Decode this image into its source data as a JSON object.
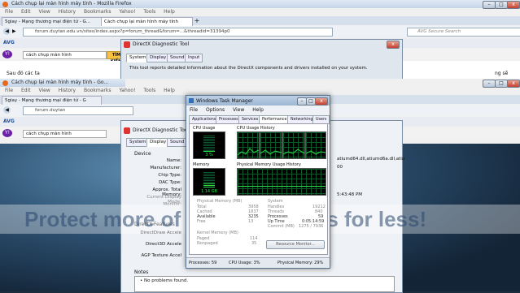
{
  "bg_browser": {
    "title": "Cách chụp lại màn hình máy tính - Mozilla Firefox",
    "menu": [
      "File",
      "Edit",
      "View",
      "History",
      "Bookmarks",
      "Yahoo!",
      "Tools",
      "Help"
    ],
    "tabs": [
      "5giay - Mạng thương mại điện tử - G...",
      "Cách chụp lại màn hình máy tính"
    ],
    "url": "forum.duytan.edu.vn/sites/index.aspx?p=forum_thread&forum=...&threadid=31394p0",
    "search_placeholder": "AVG Secure Search",
    "search_query": "cách chụp màn hình",
    "search_button": "TÌM KIẾM",
    "content_snippet": "Sau đó các ta",
    "content_snippet_right": "ng sẽ"
  },
  "bg_dxdiag": {
    "title": "DirectX Diagnostic Tool",
    "tabs": [
      "System",
      "Display",
      "Sound",
      "Input"
    ],
    "intro": "This tool reports detailed information about the DirectX components and drivers installed on your system."
  },
  "fg_browser": {
    "title": "Cách chụp lại màn hình máy tính - Go...",
    "menu": [
      "File",
      "Edit",
      "View",
      "History",
      "Bookmarks",
      "Yahoo!",
      "Tools",
      "Help"
    ],
    "tab": "5giay - Mạng thương mại điện tử - G",
    "url": "forum.duytan",
    "search_query": "cách chụp màn hình"
  },
  "fg_dxdiag": {
    "title": "DirectX Diagnostic Tool",
    "tabs": [
      "System",
      "Display",
      "Sound"
    ],
    "device_group": "Device",
    "fields": [
      "Name:",
      "Manufacturer:",
      "Chip Type:",
      "DAC Type:",
      "Approx. Total Memory:",
      "Current Display Mode:",
      "Monitor:"
    ],
    "right_values": [
      "atiumd64.dll,atiumd6a.dll,atiu",
      "00",
      "",
      "5:43:48 PM"
    ],
    "directx_features": "DirectX Features",
    "feature_rows": [
      "DirectDraw Accele",
      "Direct3D Accele",
      "AGP Texture Accel"
    ],
    "notes_label": "Notes",
    "notes_item": "No problems found."
  },
  "task_manager": {
    "title": "Windows Task Manager",
    "menu": [
      "File",
      "Options",
      "View",
      "Help"
    ],
    "tabs": [
      "Applications",
      "Processes",
      "Services",
      "Performance",
      "Networking",
      "Users"
    ],
    "active_tab": "Performance",
    "cpu_usage_label": "CPU Usage",
    "cpu_history_label": "CPU Usage History",
    "memory_label": "Memory",
    "memory_history_label": "Physical Memory Usage History",
    "cpu_value": "3 %",
    "mem_value": "1.14 GB",
    "physmem_header": "Physical Memory (MB)",
    "physmem_rows": [
      [
        "Total",
        "3958"
      ],
      [
        "Cached",
        "1837"
      ],
      [
        "Available",
        "3235"
      ],
      [
        "Free",
        "13"
      ]
    ],
    "system_header": "System",
    "system_rows": [
      [
        "Handles",
        "19212"
      ],
      [
        "Threads",
        "840"
      ],
      [
        "Processes",
        "59"
      ],
      [
        "Up Time",
        "0:05:14:59"
      ],
      [
        "Commit (MB)",
        "1275 / 7936"
      ]
    ],
    "kernel_header": "Kernel Memory (MB)",
    "kernel_rows": [
      [
        "Paged",
        "114"
      ],
      [
        "Nonpaged",
        "35"
      ]
    ],
    "resource_button": "Resource Monitor...",
    "status_processes": "Processes: 59",
    "status_cpu": "CPU Usage: 3%",
    "status_mem": "Physical Memory: 29%"
  },
  "watermark": "Protect more of your memories for less!",
  "colors": {
    "graph_green": "#29e04a",
    "graph_grid": "#0a5a2a",
    "titlebar": "#c9d9ea",
    "desktop": "#1b2c3c"
  }
}
